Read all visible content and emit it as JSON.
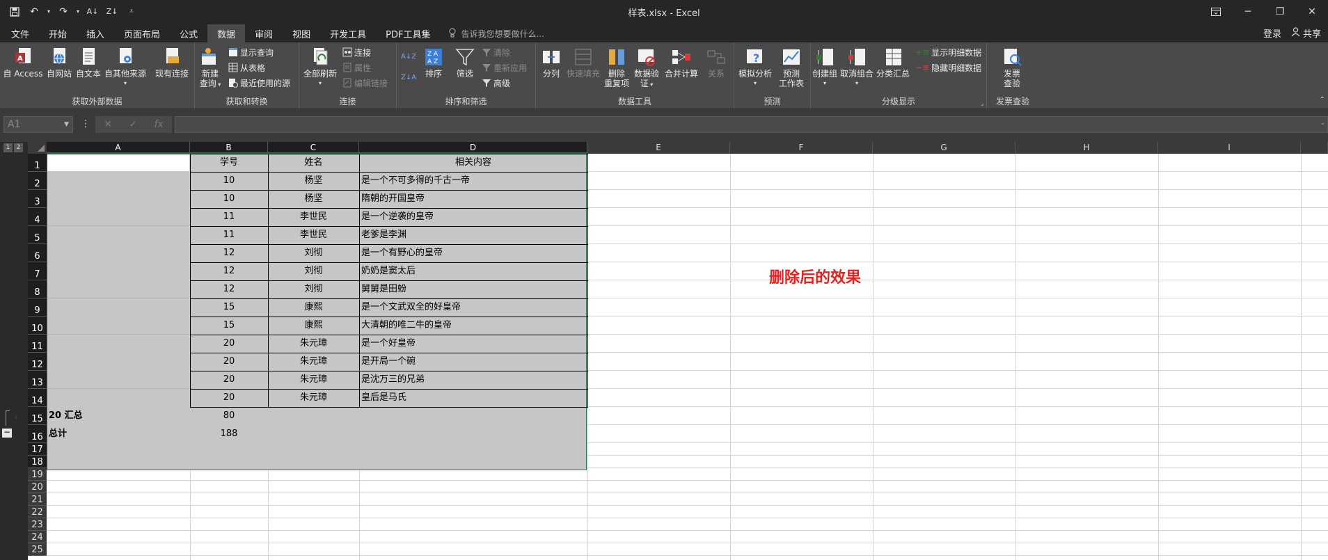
{
  "window": {
    "title": "样表.xlsx - Excel"
  },
  "qat": [
    "save",
    "undo",
    "redo",
    "sort-asc",
    "sort-desc",
    "customize"
  ],
  "menu": {
    "tabs": [
      "文件",
      "开始",
      "插入",
      "页面布局",
      "公式",
      "数据",
      "审阅",
      "视图",
      "开发工具",
      "PDF工具集"
    ],
    "active": "数据",
    "tellme": "告诉我您想要做什么...",
    "login": "登录",
    "share": "共享"
  },
  "ribbon": {
    "groups": {
      "external": "获取外部数据",
      "transform": "获取和转换",
      "connections": "连接",
      "sortfilter": "排序和筛选",
      "datatools": "数据工具",
      "forecast": "预测",
      "outline": "分级显示",
      "invoice": "发票查验"
    },
    "buttons": {
      "from_access": "自 Access",
      "from_web": "自网站",
      "from_text": "自文本",
      "from_other": "自其他来源",
      "existing": "现有连接",
      "new_query_1": "新建",
      "new_query_2": "查询",
      "show_queries": "显示查询",
      "from_table": "从表格",
      "recent_sources": "最近使用的源",
      "refresh_all": "全部刷新",
      "connections": "连接",
      "properties": "属性",
      "edit_links": "编辑链接",
      "sort": "排序",
      "filter": "筛选",
      "clear": "清除",
      "reapply": "重新应用",
      "advanced": "高级",
      "split": "分列",
      "flash_fill": "快速填充",
      "remove_dup_1": "删除",
      "remove_dup_2": "重复项",
      "validate_1": "数据验",
      "validate_2": "证",
      "consolidate": "合并计算",
      "relations": "关系",
      "whatif": "模拟分析",
      "forecast_1": "预测",
      "forecast_2": "工作表",
      "group": "创建组",
      "ungroup": "取消组合",
      "subtotal": "分类汇总",
      "show_detail": "显示明细数据",
      "hide_detail": "隐藏明细数据",
      "invoice_1": "发票",
      "invoice_2": "查验"
    }
  },
  "formula_bar": {
    "name_box": "A1",
    "fx": "fx",
    "cancel": "✕",
    "enter": "✓",
    "value": ""
  },
  "outline_levels": [
    "1",
    "2"
  ],
  "columns": [
    "A",
    "B",
    "C",
    "D",
    "E",
    "F",
    "G",
    "H",
    "I"
  ],
  "rows": [
    "1",
    "2",
    "3",
    "4",
    "5",
    "6",
    "7",
    "8",
    "9",
    "10",
    "11",
    "12",
    "13",
    "14",
    "15",
    "16",
    "17",
    "18",
    "19",
    "20",
    "21",
    "22",
    "23",
    "24",
    "25"
  ],
  "table": {
    "headers": [
      "学号",
      "姓名",
      "相关内容"
    ],
    "rows": [
      [
        "10",
        "杨坚",
        "是一个不可多得的千古一帝"
      ],
      [
        "10",
        "杨坚",
        "隋朝的开国皇帝"
      ],
      [
        "11",
        "李世民",
        "是一个逆袭的皇帝"
      ],
      [
        "11",
        "李世民",
        "老爹是李渊"
      ],
      [
        "12",
        "刘彻",
        "是一个有野心的皇帝"
      ],
      [
        "12",
        "刘彻",
        "奶奶是窦太后"
      ],
      [
        "12",
        "刘彻",
        "舅舅是田蚡"
      ],
      [
        "15",
        "康熙",
        "是一个文武双全的好皇帝"
      ],
      [
        "15",
        "康熙",
        "大清朝的唯二牛的皇帝"
      ],
      [
        "20",
        "朱元璋",
        "是一个好皇帝"
      ],
      [
        "20",
        "朱元璋",
        "是开局一个碗"
      ],
      [
        "20",
        "朱元璋",
        "是沈万三的兄弟"
      ],
      [
        "20",
        "朱元璋",
        "皇后是马氏"
      ]
    ],
    "subtotal_label": "20 汇总",
    "subtotal_value": "80",
    "total_label": "总计",
    "total_value": "188"
  },
  "annotation": "删除后的效果",
  "colors": {
    "accent": "#217346",
    "annotation": "#e32222",
    "selection": "#c6c6c6"
  }
}
